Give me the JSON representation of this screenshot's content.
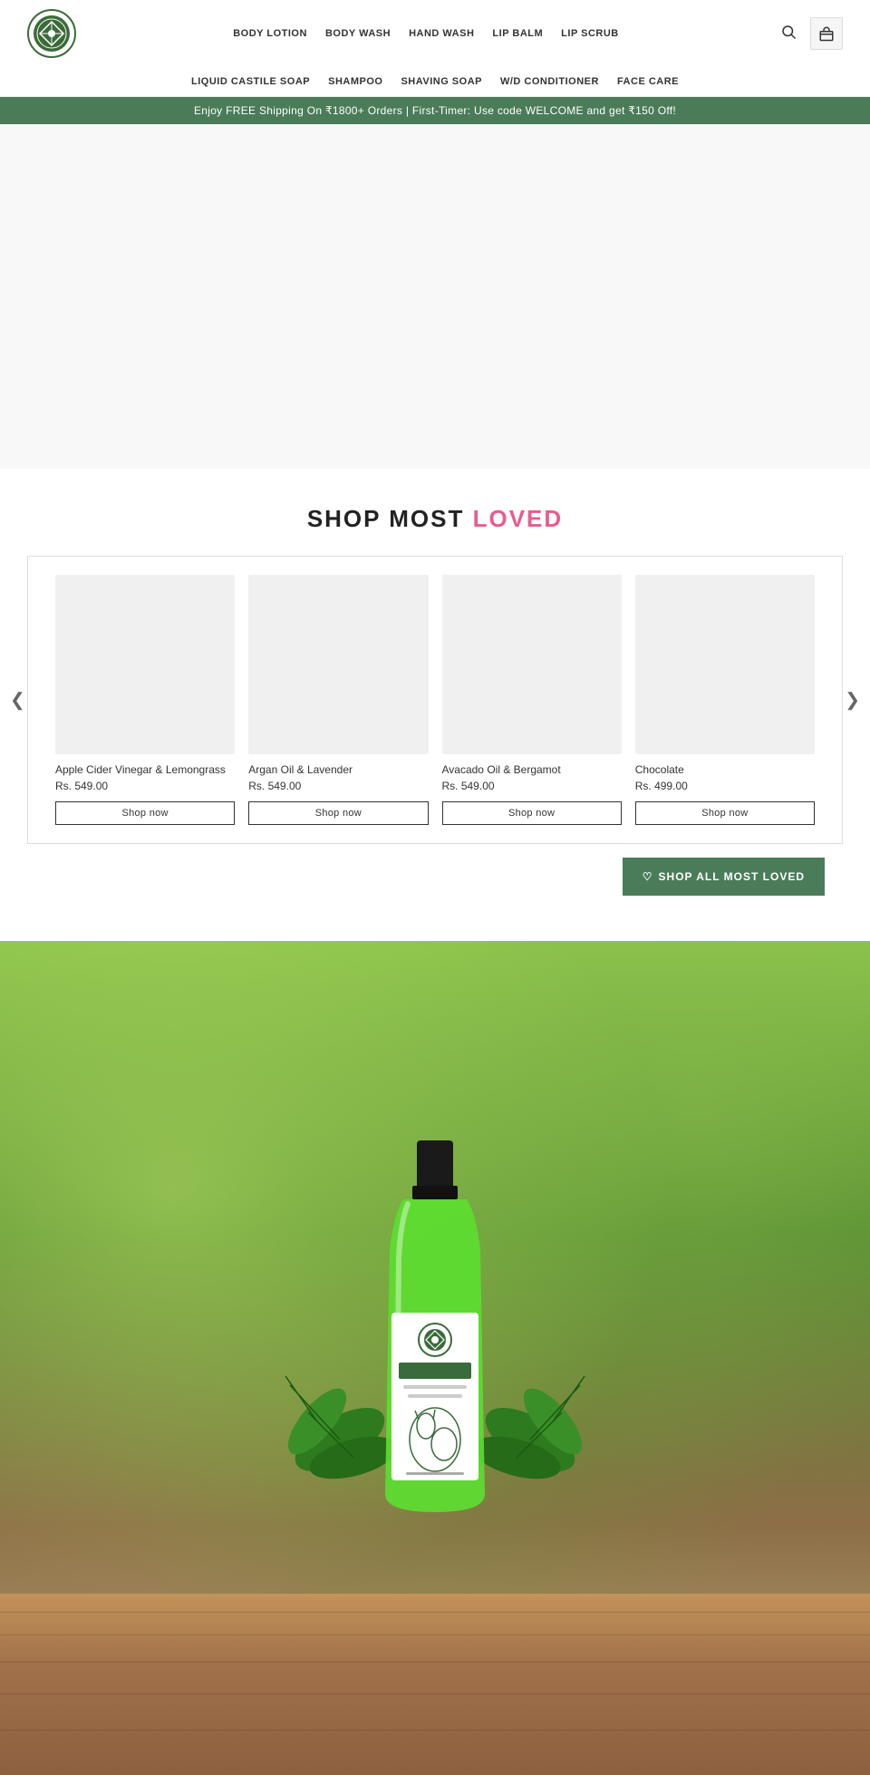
{
  "header": {
    "logo_alt": "GreenBrook Logo",
    "nav_top": [
      {
        "label": "BODY LOTION",
        "href": "#"
      },
      {
        "label": "BODY WASH",
        "href": "#"
      },
      {
        "label": "HAND WASH",
        "href": "#"
      },
      {
        "label": "LIP BALM",
        "href": "#"
      },
      {
        "label": "LIP SCRUB",
        "href": "#"
      }
    ],
    "nav_bottom": [
      {
        "label": "LIQUID CASTILE SOAP",
        "href": "#"
      },
      {
        "label": "SHAMPOO",
        "href": "#"
      },
      {
        "label": "SHAVING SOAP",
        "href": "#"
      },
      {
        "label": "W/D CONDITIONER",
        "href": "#"
      },
      {
        "label": "FACE CARE",
        "href": "#"
      }
    ]
  },
  "promo_banner": {
    "text": "Enjoy FREE Shipping On ₹1800+ Orders | First-Timer: Use code WELCOME and get ₹150 Off!"
  },
  "shop_most_loved": {
    "title_part1": "SHOP MOST ",
    "title_part2": "LOVED",
    "products": [
      {
        "name": "Apple Cider Vinegar & Lemongrass",
        "price": "Rs. 549.00",
        "shop_now_label": "Shop now"
      },
      {
        "name": "Argan Oil & Lavender",
        "price": "Rs. 549.00",
        "shop_now_label": "Shop now"
      },
      {
        "name": "Avacado Oil & Bergamot",
        "price": "Rs. 549.00",
        "shop_now_label": "Shop now"
      },
      {
        "name": "Chocolate",
        "price": "Rs. 499.00",
        "shop_now_label": "Shop now"
      }
    ],
    "shop_all_label": "SHOP ALL MOST LOVED",
    "carousel_left_arrow": "❮",
    "carousel_right_arrow": "❯"
  },
  "colors": {
    "green_dark": "#4a7c59",
    "pink_loved": "#e85d8a",
    "border": "#ddd"
  }
}
